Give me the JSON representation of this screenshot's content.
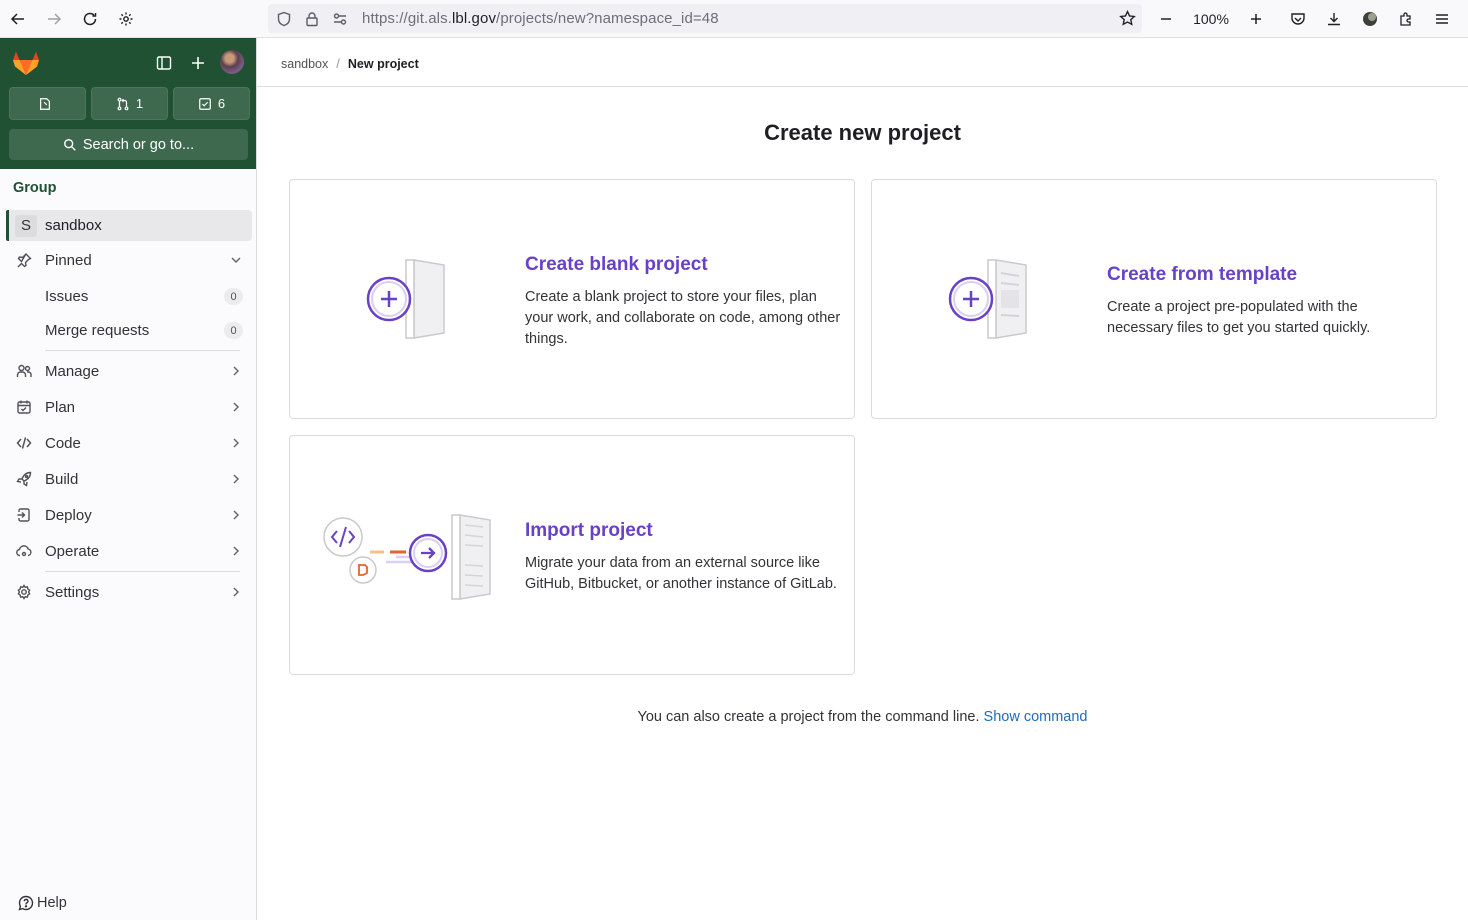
{
  "browser": {
    "url_prefix": "https://git.als.",
    "url_host": "lbl.gov",
    "url_path": "/projects/new?namespace_id=48",
    "zoom": "100%"
  },
  "sidebar": {
    "counters": [
      {
        "icon": "issues-icon",
        "count": ""
      },
      {
        "icon": "merge-request-icon",
        "count": "1"
      },
      {
        "icon": "todo-icon",
        "count": "6"
      }
    ],
    "search_label": "Search or go to...",
    "context_heading": "Group",
    "context_item": {
      "initial": "S",
      "label": "sandbox"
    },
    "pinned": {
      "label": "Pinned",
      "items": [
        {
          "label": "Issues",
          "count": "0"
        },
        {
          "label": "Merge requests",
          "count": "0"
        }
      ]
    },
    "menu": [
      {
        "label": "Manage",
        "icon": "users-icon"
      },
      {
        "label": "Plan",
        "icon": "calendar-icon"
      },
      {
        "label": "Code",
        "icon": "code-icon"
      },
      {
        "label": "Build",
        "icon": "rocket-icon"
      },
      {
        "label": "Deploy",
        "icon": "deployments-icon"
      },
      {
        "label": "Operate",
        "icon": "cloud-gear-icon"
      }
    ],
    "settings_label": "Settings",
    "help_label": "Help"
  },
  "main": {
    "breadcrumbs": [
      "sandbox",
      "New project"
    ],
    "title": "Create new project",
    "cards": [
      {
        "title": "Create blank project",
        "description": "Create a blank project to store your files, plan your work, and collaborate on code, among other things."
      },
      {
        "title": "Create from template",
        "description": "Create a project pre-populated with the necessary files to get you started quickly."
      },
      {
        "title": "Import project",
        "description": "Migrate your data from an external source like GitHub, Bitbucket, or another instance of GitLab."
      }
    ],
    "cli_text": "You can also create a project from the command line.",
    "cli_link": "Show command"
  },
  "colors": {
    "sidebar_header": "#1f5132",
    "accent_purple": "#6941c6",
    "link_blue": "#1f6bba"
  }
}
